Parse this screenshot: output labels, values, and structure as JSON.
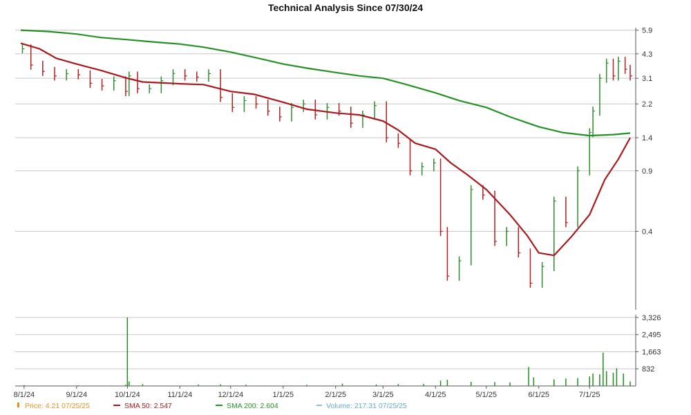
{
  "chart_data": {
    "type": "line",
    "title": "Technical Analysis Since 07/30/24",
    "x_tick_labels": [
      "8/1/24",
      "9/1/24",
      "10/1/24",
      "11/1/24",
      "12/1/24",
      "1/1/25",
      "2/1/25",
      "3/1/25",
      "4/1/25",
      "5/1/25",
      "6/1/25",
      "7/1/25"
    ],
    "x_range": [
      "2024-07-30",
      "2025-07-25"
    ],
    "price_axis": {
      "scale": "log",
      "tick_labels": [
        "5.9",
        "4.3",
        "3.1",
        "2.2",
        "1.4",
        "0.9",
        "0.4"
      ],
      "ylim": [
        0.14,
        6.1
      ]
    },
    "volume_axis": {
      "tick_labels": [
        "3,326",
        "2,495",
        "1,663",
        "832"
      ],
      "ylim": [
        0,
        3326
      ]
    },
    "grid": true,
    "legend_position": "bottom",
    "legend": [
      {
        "key": "price",
        "label": "Price: 4.21  07/25/25",
        "color": "#e8901c"
      },
      {
        "key": "sma50",
        "label": "SMA 50: 2.547",
        "color": "#a8181c"
      },
      {
        "key": "sma200",
        "label": "SMA 200: 2.604",
        "color": "#259125"
      },
      {
        "key": "volume",
        "label": "Volume: 217.31  07/25/25",
        "color": "#66aacc"
      }
    ],
    "series": [
      {
        "name": "SMA 200",
        "color": "#259125",
        "points": [
          [
            "2024-07-30",
            5.9
          ],
          [
            "2024-08-15",
            5.8
          ],
          [
            "2024-09-01",
            5.6
          ],
          [
            "2024-09-15",
            5.35
          ],
          [
            "2024-10-01",
            5.2
          ],
          [
            "2024-10-15",
            5.05
          ],
          [
            "2024-11-01",
            4.9
          ],
          [
            "2024-11-15",
            4.7
          ],
          [
            "2024-12-01",
            4.4
          ],
          [
            "2024-12-15",
            4.1
          ],
          [
            "2025-01-01",
            3.75
          ],
          [
            "2025-01-15",
            3.55
          ],
          [
            "2025-02-01",
            3.35
          ],
          [
            "2025-02-15",
            3.2
          ],
          [
            "2025-03-01",
            3.1
          ],
          [
            "2025-03-15",
            2.85
          ],
          [
            "2025-04-01",
            2.55
          ],
          [
            "2025-04-15",
            2.3
          ],
          [
            "2025-05-01",
            2.1
          ],
          [
            "2025-05-15",
            1.85
          ],
          [
            "2025-06-01",
            1.62
          ],
          [
            "2025-06-15",
            1.5
          ],
          [
            "2025-07-01",
            1.44
          ],
          [
            "2025-07-15",
            1.46
          ],
          [
            "2025-07-25",
            1.49
          ]
        ]
      },
      {
        "name": "SMA 50",
        "color": "#a8181c",
        "points": [
          [
            "2024-07-30",
            4.95
          ],
          [
            "2024-08-10",
            4.6
          ],
          [
            "2024-08-20",
            4.05
          ],
          [
            "2024-09-01",
            3.75
          ],
          [
            "2024-09-15",
            3.45
          ],
          [
            "2024-10-01",
            3.1
          ],
          [
            "2024-10-10",
            2.95
          ],
          [
            "2024-10-20",
            2.92
          ],
          [
            "2024-11-01",
            2.88
          ],
          [
            "2024-11-15",
            2.85
          ],
          [
            "2024-12-01",
            2.6
          ],
          [
            "2024-12-15",
            2.5
          ],
          [
            "2025-01-01",
            2.25
          ],
          [
            "2025-01-15",
            2.05
          ],
          [
            "2025-02-01",
            1.95
          ],
          [
            "2025-02-15",
            1.9
          ],
          [
            "2025-03-01",
            1.75
          ],
          [
            "2025-03-10",
            1.55
          ],
          [
            "2025-03-20",
            1.3
          ],
          [
            "2025-04-01",
            1.2
          ],
          [
            "2025-04-10",
            1.0
          ],
          [
            "2025-04-20",
            0.85
          ],
          [
            "2025-05-01",
            0.7
          ],
          [
            "2025-05-15",
            0.5
          ],
          [
            "2025-05-25",
            0.38
          ],
          [
            "2025-06-01",
            0.3
          ],
          [
            "2025-06-10",
            0.29
          ],
          [
            "2025-06-20",
            0.37
          ],
          [
            "2025-07-01",
            0.5
          ],
          [
            "2025-07-10",
            0.8
          ],
          [
            "2025-07-18",
            1.05
          ],
          [
            "2025-07-25",
            1.4
          ]
        ]
      },
      {
        "name": "Price",
        "color": "#2d8c2d",
        "points": [
          [
            "2024-07-31",
            4.6
          ],
          [
            "2024-08-05",
            3.7
          ],
          [
            "2024-08-12",
            3.4
          ],
          [
            "2024-08-19",
            3.2
          ],
          [
            "2024-08-26",
            3.3
          ],
          [
            "2024-09-02",
            3.25
          ],
          [
            "2024-09-09",
            2.9
          ],
          [
            "2024-09-16",
            2.8
          ],
          [
            "2024-09-23",
            3.0
          ],
          [
            "2024-09-30",
            2.6
          ],
          [
            "2024-10-02",
            3.2
          ],
          [
            "2024-10-07",
            2.7
          ],
          [
            "2024-10-14",
            2.7
          ],
          [
            "2024-10-21",
            3.0
          ],
          [
            "2024-10-28",
            3.3
          ],
          [
            "2024-11-04",
            3.2
          ],
          [
            "2024-11-11",
            3.15
          ],
          [
            "2024-11-18",
            3.3
          ],
          [
            "2024-11-25",
            2.4
          ],
          [
            "2024-12-02",
            2.1
          ],
          [
            "2024-12-09",
            2.3
          ],
          [
            "2024-12-16",
            2.2
          ],
          [
            "2024-12-23",
            2.0
          ],
          [
            "2024-12-30",
            1.85
          ],
          [
            "2025-01-06",
            2.1
          ],
          [
            "2025-01-13",
            2.2
          ],
          [
            "2025-01-20",
            1.9
          ],
          [
            "2025-01-27",
            2.1
          ],
          [
            "2025-02-03",
            2.0
          ],
          [
            "2025-02-10",
            1.7
          ],
          [
            "2025-02-17",
            1.9
          ],
          [
            "2025-02-24",
            2.15
          ],
          [
            "2025-03-03",
            1.4
          ],
          [
            "2025-03-10",
            1.3
          ],
          [
            "2025-03-17",
            0.9
          ],
          [
            "2025-03-24",
            0.95
          ],
          [
            "2025-03-31",
            1.0
          ],
          [
            "2025-04-04",
            0.4
          ],
          [
            "2025-04-08",
            0.22
          ],
          [
            "2025-04-15",
            0.27
          ],
          [
            "2025-04-22",
            0.7
          ],
          [
            "2025-04-29",
            0.65
          ],
          [
            "2025-05-06",
            0.35
          ],
          [
            "2025-05-13",
            0.4
          ],
          [
            "2025-05-20",
            0.3
          ],
          [
            "2025-05-27",
            0.2
          ],
          [
            "2025-06-03",
            0.25
          ],
          [
            "2025-06-10",
            0.6
          ],
          [
            "2025-06-17",
            0.45
          ],
          [
            "2025-06-24",
            0.9
          ],
          [
            "2025-07-01",
            1.5
          ],
          [
            "2025-07-03",
            2.0
          ],
          [
            "2025-07-07",
            3.1
          ],
          [
            "2025-07-11",
            3.8
          ],
          [
            "2025-07-15",
            3.2
          ],
          [
            "2025-07-18",
            3.9
          ],
          [
            "2025-07-22",
            3.5
          ],
          [
            "2025-07-25",
            3.2
          ]
        ]
      }
    ],
    "volume": [
      [
        "2024-08-01",
        40
      ],
      [
        "2024-09-02",
        35
      ],
      [
        "2024-09-30",
        60
      ],
      [
        "2024-10-01",
        3326
      ],
      [
        "2024-10-02",
        220
      ],
      [
        "2024-10-10",
        90
      ],
      [
        "2024-11-12",
        70
      ],
      [
        "2024-11-25",
        80
      ],
      [
        "2024-12-10",
        60
      ],
      [
        "2025-01-15",
        55
      ],
      [
        "2025-02-05",
        110
      ],
      [
        "2025-02-25",
        70
      ],
      [
        "2025-03-10",
        90
      ],
      [
        "2025-03-25",
        95
      ],
      [
        "2025-04-04",
        260
      ],
      [
        "2025-04-08",
        300
      ],
      [
        "2025-04-22",
        200
      ],
      [
        "2025-05-06",
        190
      ],
      [
        "2025-05-15",
        170
      ],
      [
        "2025-05-26",
        920
      ],
      [
        "2025-05-29",
        420
      ],
      [
        "2025-06-10",
        320
      ],
      [
        "2025-06-17",
        360
      ],
      [
        "2025-06-24",
        380
      ],
      [
        "2025-07-01",
        460
      ],
      [
        "2025-07-03",
        600
      ],
      [
        "2025-07-07",
        560
      ],
      [
        "2025-07-09",
        1620
      ],
      [
        "2025-07-11",
        720
      ],
      [
        "2025-07-15",
        640
      ],
      [
        "2025-07-17",
        860
      ],
      [
        "2025-07-21",
        600
      ],
      [
        "2025-07-25",
        217.31
      ]
    ]
  }
}
